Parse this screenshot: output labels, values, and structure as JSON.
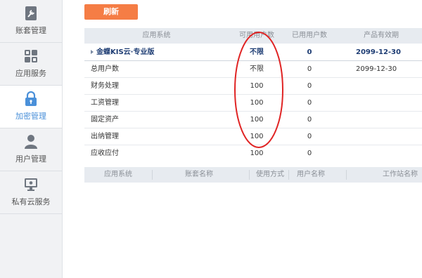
{
  "sidebar": {
    "items": [
      {
        "label": "账套管理",
        "icon": "wrench-doc-icon"
      },
      {
        "label": "应用服务",
        "icon": "apps-grid-icon"
      },
      {
        "label": "加密管理",
        "icon": "lock-icon"
      },
      {
        "label": "用户管理",
        "icon": "user-icon"
      },
      {
        "label": "私有云服务",
        "icon": "monitor-icon"
      }
    ],
    "active_index": 2
  },
  "toolbar": {
    "refresh_label": "刷新"
  },
  "license_table": {
    "headers": [
      "应用系统",
      "可用用户数",
      "已用用户数",
      "产品有效期"
    ],
    "group": {
      "name": "金蝶KIS云·专业版",
      "available": "不限",
      "used": "0",
      "expiry": "2099-12-30"
    },
    "rows": [
      {
        "name": "总用户数",
        "available": "不限",
        "used": "0",
        "expiry": "2099-12-30"
      },
      {
        "name": "财务处理",
        "available": "100",
        "used": "0",
        "expiry": ""
      },
      {
        "name": "工资管理",
        "available": "100",
        "used": "0",
        "expiry": ""
      },
      {
        "name": "固定资产",
        "available": "100",
        "used": "0",
        "expiry": ""
      },
      {
        "name": "出纳管理",
        "available": "100",
        "used": "0",
        "expiry": ""
      },
      {
        "name": "应收应付",
        "available": "100",
        "used": "0",
        "expiry": ""
      }
    ]
  },
  "usage_table": {
    "headers": [
      "应用系统",
      "账套名称",
      "使用方式",
      "用户名称",
      "工作站名称"
    ]
  },
  "colors": {
    "accent_orange": "#f57d45",
    "active_blue": "#4a90d9",
    "annotation_red": "#e02424",
    "group_text": "#1d3c73"
  }
}
